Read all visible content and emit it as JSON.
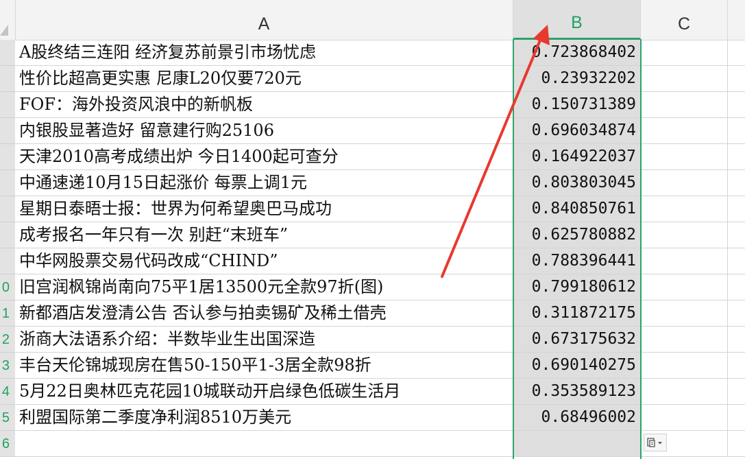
{
  "columns": {
    "a": "A",
    "b": "B",
    "c": "C"
  },
  "row_numbers": [
    "",
    "",
    "",
    "",
    "",
    "",
    "",
    "",
    "",
    "0",
    "1",
    "2",
    "3",
    "4",
    "5",
    "6"
  ],
  "rows": [
    {
      "a": "A股终结三连阳 经济复苏前景引市场忧虑",
      "b": "0.723868402"
    },
    {
      "a": "性价比超高更实惠 尼康L20仅要720元",
      "b": "0.23932202"
    },
    {
      "a": "FOF：海外投资风浪中的新帆板",
      "b": "0.150731389"
    },
    {
      "a": "内银股显著造好 留意建行购25106",
      "b": "0.696034874"
    },
    {
      "a": "天津2010高考成绩出炉 今日1400起可查分",
      "b": "0.164922037"
    },
    {
      "a": "中通速递10月15日起涨价 每票上调1元",
      "b": "0.803803045"
    },
    {
      "a": "星期日泰晤士报：世界为何希望奥巴马成功",
      "b": "0.840850761"
    },
    {
      "a": "成考报名一年只有一次 别赶“末班车”",
      "b": "0.625780882"
    },
    {
      "a": "中华网股票交易代码改成“CHIND”",
      "b": "0.788396441"
    },
    {
      "a": "旧宫润枫锦尚南向75平1居13500元全款97折(图)",
      "b": "0.799180612"
    },
    {
      "a": "新都酒店发澄清公告 否认参与拍卖锡矿及稀土借壳",
      "b": "0.311872175"
    },
    {
      "a": "浙商大法语系介绍：半数毕业生出国深造",
      "b": "0.673175632"
    },
    {
      "a": "丰台天伦锦城现房在售50-150平1-3居全款98折",
      "b": "0.690140275"
    },
    {
      "a": "5月22日奥林匹克花园10城联动开启绿色低碳生活月",
      "b": "0.353589123"
    },
    {
      "a": "利盟国际第二季度净利润8510万美元",
      "b": "0.68496002"
    },
    {
      "a": "",
      "b": ""
    }
  ],
  "colors": {
    "selection": "#2aa36a",
    "annotation_arrow": "#e8392f",
    "selected_header_text": "#1fa35c"
  },
  "icons": {
    "paste_options": "paste-options-icon",
    "select_all": "select-all-triangle-icon"
  }
}
